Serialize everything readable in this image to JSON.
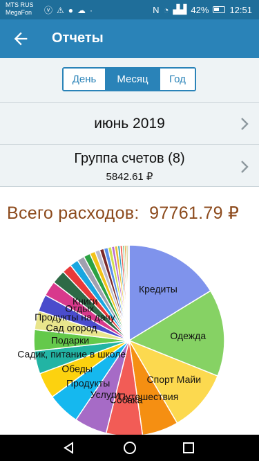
{
  "status": {
    "carrier_line1": "MTS RUS",
    "carrier_line2": "MegaFon",
    "battery": "42%",
    "time": "12:51",
    "network": "N"
  },
  "app_bar": {
    "title": "Отчеты"
  },
  "period_tabs": {
    "day": "День",
    "month": "Месяц",
    "year": "Год",
    "selected": "Месяц"
  },
  "month_row": {
    "label": "июнь 2019"
  },
  "group_row": {
    "label": "Группа счетов (8)",
    "sum": "5842.61 ₽"
  },
  "total": {
    "label": "Всего расходов:",
    "value": "97761.79 ₽"
  },
  "chart_data": {
    "type": "pie",
    "slices": [
      {
        "label": "Кредиты",
        "value": 15.9,
        "color": "#7f93ec"
      },
      {
        "label": "Одежда",
        "value": 14.4,
        "color": "#86d264"
      },
      {
        "label": "Спорт Майи",
        "value": 10.3,
        "color": "#fcd94f"
      },
      {
        "label": "Путешествия",
        "value": 6.0,
        "color": "#f58f12"
      },
      {
        "label": "Собака",
        "value": 6.0,
        "color": "#f25c56"
      },
      {
        "label": "Услуги",
        "value": 5.4,
        "color": "#a66bc6"
      },
      {
        "label": "Продукты",
        "value": 5.4,
        "color": "#15b8ef"
      },
      {
        "label": "Обеды",
        "value": 4.3,
        "color": "#fcd20f"
      },
      {
        "label": "Садик, питание в школе",
        "value": 3.8,
        "color": "#22b4a4"
      },
      {
        "label": "Подарки",
        "value": 3.5,
        "color": "#64c94b"
      },
      {
        "label": "Сад огород",
        "value": 3.1,
        "color": "#e9e58c"
      },
      {
        "label": "Продукты на дачу",
        "value": 2.8,
        "color": "#4a4ccc"
      },
      {
        "label": "Отдых",
        "value": 2.5,
        "color": "#d8398c"
      },
      {
        "label": "Книги",
        "value": 2.3,
        "color": "#2e6a46"
      },
      {
        "label": "",
        "value": 1.6,
        "color": "#e8393a"
      },
      {
        "label": "",
        "value": 1.4,
        "color": "#1aa6e0"
      },
      {
        "label": "",
        "value": 1.2,
        "color": "#a0a0b0"
      },
      {
        "label": "",
        "value": 1.1,
        "color": "#2ba243"
      },
      {
        "label": "",
        "value": 0.9,
        "color": "#f2c318"
      },
      {
        "label": "",
        "value": 0.8,
        "color": "#bbbbcc"
      },
      {
        "label": "",
        "value": 0.7,
        "color": "#7a2a2a"
      },
      {
        "label": "",
        "value": 0.7,
        "color": "#5890ec"
      },
      {
        "label": "",
        "value": 0.6,
        "color": "#d0e050"
      },
      {
        "label": "",
        "value": 0.5,
        "color": "#b86bd0"
      },
      {
        "label": "",
        "value": 0.5,
        "color": "#e8c030"
      },
      {
        "label": "",
        "value": 0.4,
        "color": "#30a0c0"
      },
      {
        "label": "",
        "value": 0.4,
        "color": "#f06050"
      },
      {
        "label": "",
        "value": 0.3,
        "color": "#60c070"
      },
      {
        "label": "",
        "value": 0.3,
        "color": "#f0a040"
      },
      {
        "label": "",
        "value": 0.3,
        "color": "#c0c060"
      },
      {
        "label": "",
        "value": 0.2,
        "color": "#8888ff"
      }
    ]
  }
}
